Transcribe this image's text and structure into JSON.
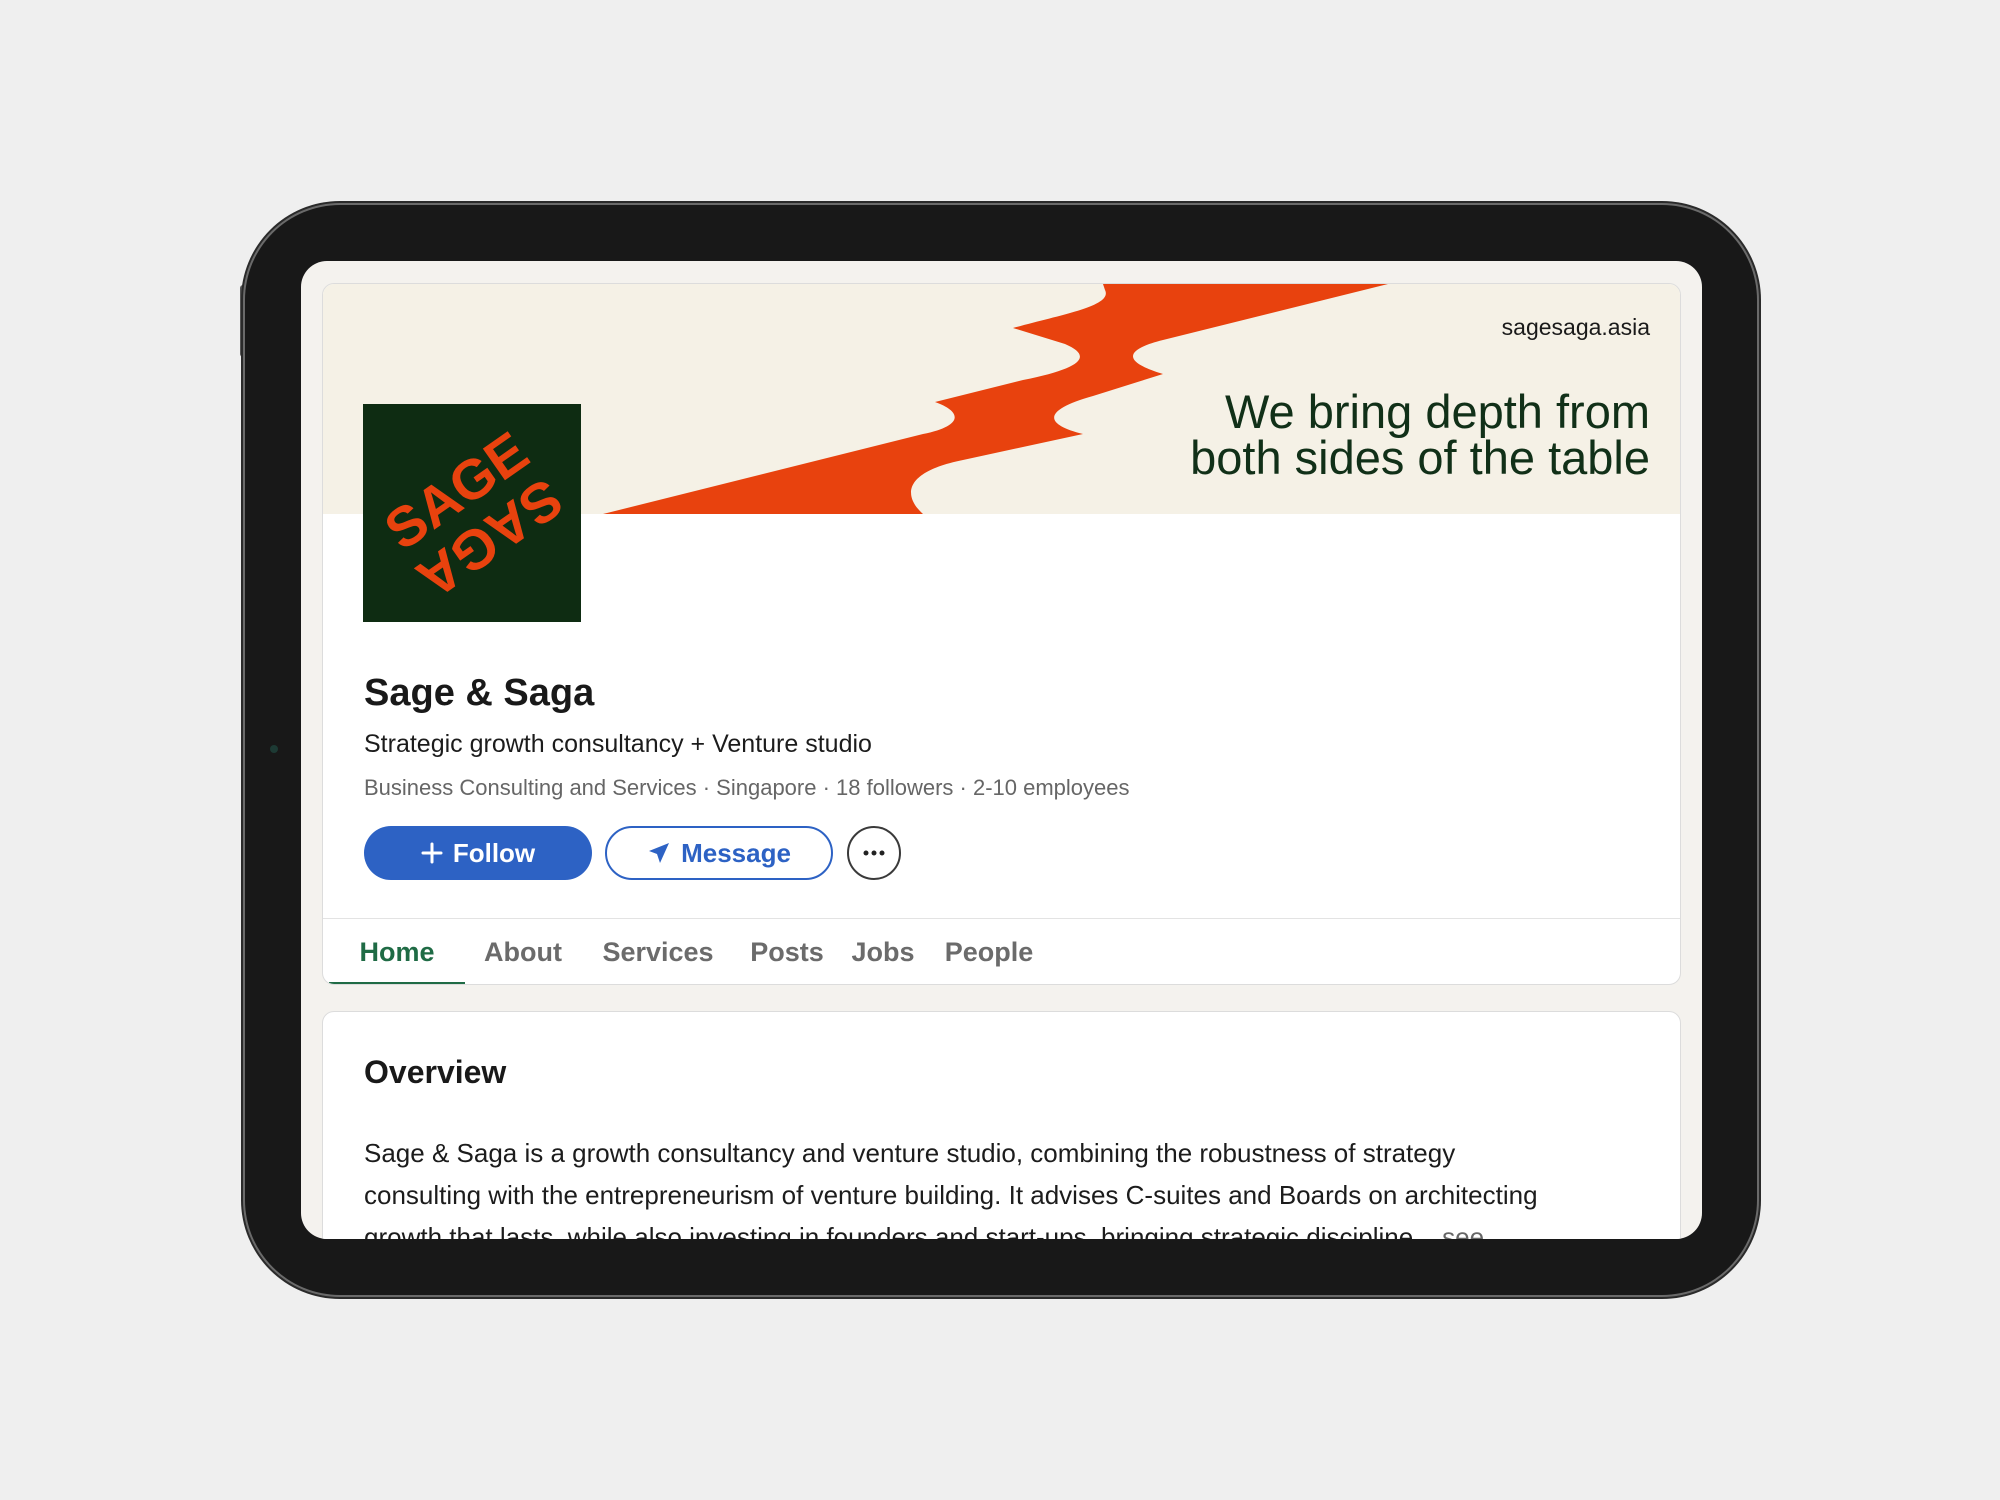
{
  "banner": {
    "url": "sagesaga.asia",
    "tagline_line1": "We bring depth from",
    "tagline_line2": "both sides of the table"
  },
  "logo": {
    "text_top": "SAGE",
    "text_bottom": "SAGA",
    "background": "#0e2c12",
    "accent": "#e8420e"
  },
  "company": {
    "name": "Sage & Saga",
    "tagline": "Strategic growth consultancy + Venture studio",
    "meta": "Business Consulting and Services · Singapore · 18 followers · 2-10 employees"
  },
  "actions": {
    "follow_label": "Follow",
    "follow_icon": "plus-icon",
    "message_label": "Message",
    "message_icon": "paper-plane-icon",
    "more_icon": "ellipsis-icon"
  },
  "tabs": [
    {
      "label": "Home",
      "active": true
    },
    {
      "label": "About",
      "active": false
    },
    {
      "label": "Services",
      "active": false
    },
    {
      "label": "Posts",
      "active": false
    },
    {
      "label": "Jobs",
      "active": false
    },
    {
      "label": "People",
      "active": false
    }
  ],
  "overview": {
    "title": "Overview",
    "line1": "Sage & Saga is a growth consultancy and venture studio, combining the robustness of strategy",
    "line2": "consulting with the entrepreneurism of venture building. It advises C-suites and Boards on architecting",
    "line3": "growth that lasts, while also investing in founders and start-ups, bringing strategic discipline",
    "see_more": "...see"
  },
  "colors": {
    "primary_blue": "#2d62c4",
    "active_tab_green": "#1f6b45",
    "brand_orange": "#e8420e",
    "brand_dark_green": "#0e2c12",
    "banner_cream": "#f5f1e6"
  }
}
